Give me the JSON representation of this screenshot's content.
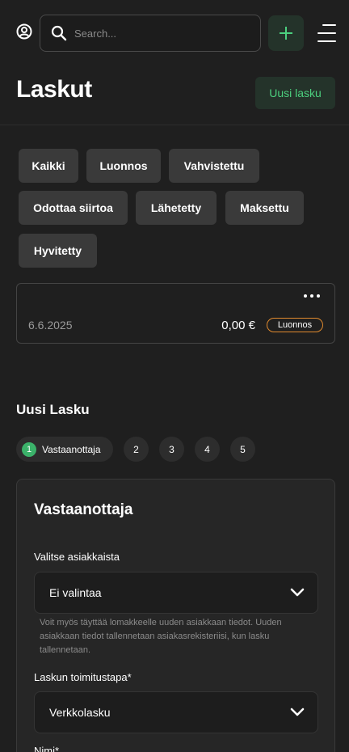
{
  "header": {
    "search_placeholder": "Search...",
    "icons": {
      "user": "user-circle-icon",
      "search": "search-icon",
      "add": "plus-icon",
      "menu": "menu-icon"
    },
    "accent_color": "#4ccf7e"
  },
  "page": {
    "title": "Laskut",
    "new_invoice_label": "Uusi lasku"
  },
  "filters": [
    {
      "label": "Kaikki"
    },
    {
      "label": "Luonnos"
    },
    {
      "label": "Vahvistettu"
    },
    {
      "label": "Odottaa siirtoa"
    },
    {
      "label": "Lähetetty"
    },
    {
      "label": "Maksettu"
    },
    {
      "label": "Hyvitetty"
    }
  ],
  "invoice_card": {
    "date": "6.6.2025",
    "amount": "0,00 €",
    "status": "Luonnos",
    "status_color": "#e08a2e"
  },
  "new_invoice": {
    "title": "Uusi Lasku",
    "steps": [
      {
        "number": "1",
        "label": "Vastaanottaja"
      },
      {
        "number": "2"
      },
      {
        "number": "3"
      },
      {
        "number": "4"
      },
      {
        "number": "5"
      }
    ],
    "form": {
      "heading": "Vastaanottaja",
      "customer_label": "Valitse asiakkaista",
      "customer_value": "Ei valintaa",
      "customer_help": "Voit myös täyttää lomakkeelle uuden asiakkaan tiedot. Uuden asiakkaan tiedot tallennetaan asiakasrekisteriisi, kun lasku tallennetaan.",
      "delivery_label": "Laskun toimitustapa*",
      "delivery_value": "Verkkolasku",
      "name_label": "Nimi*"
    }
  }
}
